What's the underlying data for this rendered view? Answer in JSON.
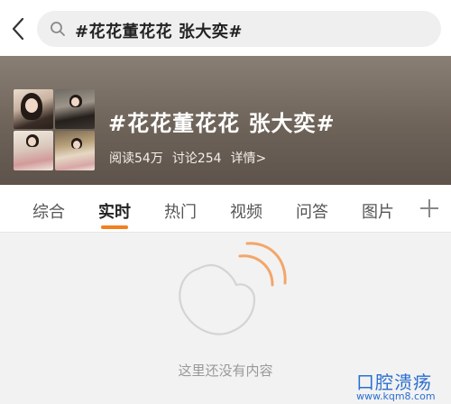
{
  "search": {
    "query": "#花花董花花 张大奕#"
  },
  "topic": {
    "title": "#花花董花花 张大奕#",
    "reads": "阅读54万",
    "discussions": "讨论254",
    "details": "详情>"
  },
  "tabs": [
    {
      "label": "综合"
    },
    {
      "label": "实时"
    },
    {
      "label": "热门"
    },
    {
      "label": "视频"
    },
    {
      "label": "问答"
    },
    {
      "label": "图片"
    }
  ],
  "active_tab": "实时",
  "empty_state": {
    "message": "这里还没有内容"
  },
  "watermark": {
    "title": "口腔溃疡",
    "url": "www.kqm8.com"
  },
  "colors": {
    "accent": "#f47f1e",
    "watermark": "#2a6fd1"
  }
}
